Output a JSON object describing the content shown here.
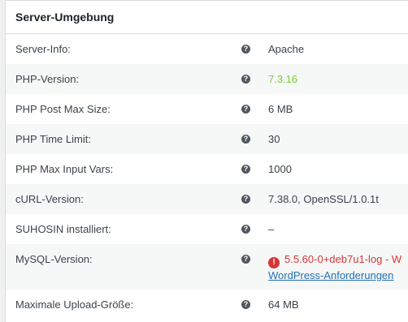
{
  "section": {
    "title": "Server-Umgebung"
  },
  "rows": [
    {
      "label": "Server-Info:",
      "value": "Apache"
    },
    {
      "label": "PHP-Version:",
      "value": "7.3.16"
    },
    {
      "label": "PHP Post Max Size:",
      "value": "6 MB"
    },
    {
      "label": "PHP Time Limit:",
      "value": "30"
    },
    {
      "label": "PHP Max Input Vars:",
      "value": "1000"
    },
    {
      "label": "cURL-Version:",
      "value": "7.38.0, OpenSSL/1.0.1t"
    },
    {
      "label": "SUHOSIN installiert:",
      "value": "–"
    },
    {
      "label": "MySQL-Version:",
      "value": "5.5.60-0+deb7u1-log - W",
      "link": "WordPress-Anforderungen"
    },
    {
      "label": "Maximale Upload-Größe:",
      "value": "64 MB"
    }
  ],
  "icons": {
    "help": "help-icon",
    "error": "error-icon"
  },
  "colors": {
    "ok": "#7ad03a",
    "error": "#d63638",
    "link": "#2271b1"
  }
}
